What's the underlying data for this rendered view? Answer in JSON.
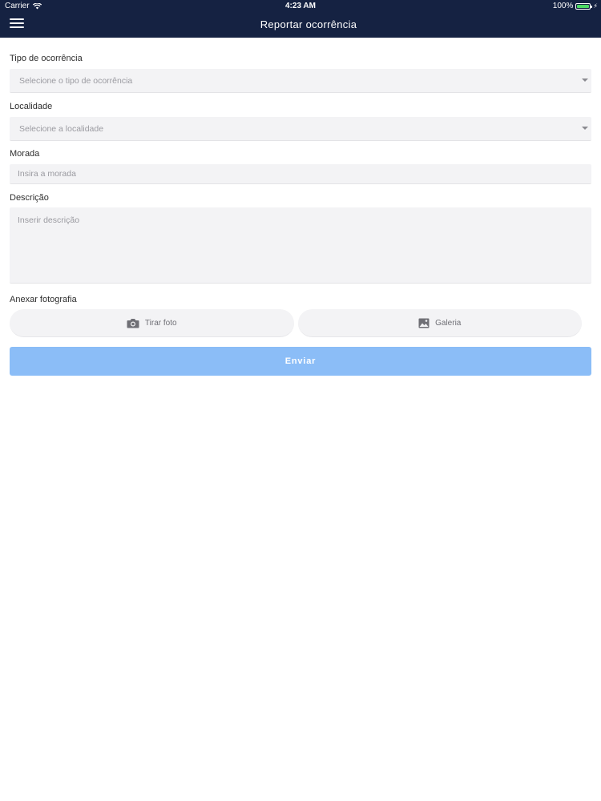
{
  "status_bar": {
    "carrier": "Carrier",
    "time": "4:23 AM",
    "battery": "100%"
  },
  "header": {
    "title": "Reportar ocorrência",
    "menu_icon": "hamburger-menu-icon"
  },
  "form": {
    "tipo": {
      "label": "Tipo de ocorrência",
      "placeholder": "Selecione o tipo de ocorrência"
    },
    "localidade": {
      "label": "Localidade",
      "placeholder": "Selecione a localidade"
    },
    "morada": {
      "label": "Morada",
      "placeholder": "Insira a morada"
    },
    "descricao": {
      "label": "Descrição",
      "placeholder": "Inserir descrição"
    },
    "anexar": {
      "label": "Anexar fotografia",
      "camera_label": "Tirar foto",
      "gallery_label": "Galeria"
    },
    "submit_label": "Enviar"
  },
  "colors": {
    "header_bg": "#152242",
    "submit_bg": "#8bbdf7",
    "field_bg": "#f3f3f5",
    "battery": "#4cd964"
  }
}
